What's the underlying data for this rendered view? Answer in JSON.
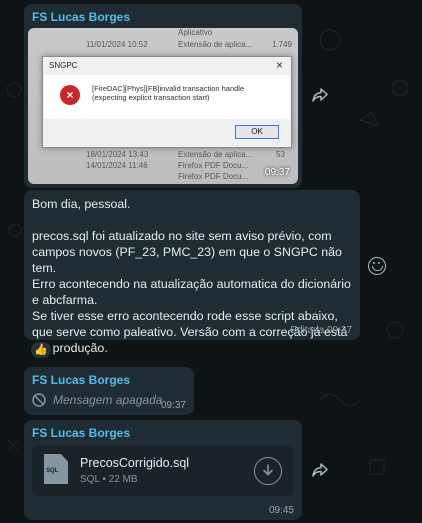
{
  "image_message": {
    "sender": "FS Lucas Borges",
    "time": "09:37",
    "screenshot": {
      "rows_top": [
        {
          "date": "11/01/2024 10:52",
          "type": "Extensão de aplica...",
          "size": "1.749"
        },
        {
          "date": "",
          "type": "Aplicativo",
          "size": ""
        }
      ],
      "rows_bottom": [
        {
          "date": "18/01/2024 13:43",
          "type": "Extensão de aplica...",
          "size": "53"
        },
        {
          "date": "14/01/2024 11:46",
          "type": "Firefox PDF Docu...",
          "size": ""
        },
        {
          "date": "",
          "type": "Firefox PDF Docu...",
          "size": ""
        }
      ],
      "dialog_title": "SNGPC",
      "dialog_message": "[FireDAC][Phys][FB]invalid transaction handle (expecting explicit transaction start)",
      "dialog_ok": "OK"
    }
  },
  "text_message": {
    "greeting": "Bom dia, pessoal.",
    "body": "precos.sql foi atualizado no site sem aviso prévio, com campos novos (PF_23, PMC_23) em que o SNGPC não tem.\nErro acontecendo na atualização automatica do dicionário e abcfarma.\nSe tiver esse erro acontecendo rode esse script abaixo, que serve como paleativo. Versão com a correção já está em produção.",
    "time": "Editada 09:37",
    "reaction": "👍"
  },
  "deleted_message": {
    "sender": "FS Lucas Borges",
    "text": "Mensagem apagada",
    "time": "09:37"
  },
  "document_message": {
    "sender": "FS Lucas Borges",
    "file_name": "PrecosCorrigido.sql",
    "file_type": "SQL",
    "file_size": "22 MB",
    "file_icon_label": "SQL",
    "time": "09:45"
  },
  "icons": [
    "forward-icon",
    "emoji-icon",
    "deleted-icon",
    "download-icon",
    "file-icon",
    "error-icon"
  ],
  "colors": {
    "background": "#0e1416",
    "bubble": "#202c33",
    "sender": "#53bdeb"
  }
}
